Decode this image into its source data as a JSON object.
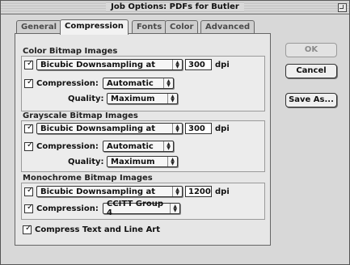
{
  "window": {
    "title": "Job Options: PDFs for Butler",
    "zoom_icon": "zoom-box-icon"
  },
  "tabs": [
    {
      "label": "General",
      "active": false
    },
    {
      "label": "Compression",
      "active": true
    },
    {
      "label": "Fonts",
      "active": false
    },
    {
      "label": "Color",
      "active": false
    },
    {
      "label": "Advanced",
      "active": false
    }
  ],
  "color": {
    "title": "Color Bitmap Images",
    "sampling": {
      "checked": true,
      "value": "Bicubic Downsampling at",
      "dpi": "300",
      "unit": "dpi"
    },
    "compression": {
      "checked": true,
      "label": "Compression:",
      "value": "Automatic"
    },
    "quality": {
      "label": "Quality:",
      "value": "Maximum"
    }
  },
  "grayscale": {
    "title": "Grayscale Bitmap Images",
    "sampling": {
      "checked": true,
      "value": "Bicubic Downsampling at",
      "dpi": "300",
      "unit": "dpi"
    },
    "compression": {
      "checked": true,
      "label": "Compression:",
      "value": "Automatic"
    },
    "quality": {
      "label": "Quality:",
      "value": "Maximum"
    }
  },
  "mono": {
    "title": "Monochrome Bitmap Images",
    "sampling": {
      "checked": true,
      "value": "Bicubic Downsampling at",
      "dpi": "1200",
      "unit": "dpi"
    },
    "compression": {
      "checked": true,
      "label": "Compression:",
      "value": "CCITT Group 4"
    }
  },
  "compress_text": {
    "checked": true,
    "label": "Compress Text and Line Art"
  },
  "buttons": {
    "ok": "OK",
    "cancel": "Cancel",
    "save_as": "Save As..."
  },
  "glyphs": {
    "check": "✓",
    "up": "▲",
    "down": "▼"
  }
}
